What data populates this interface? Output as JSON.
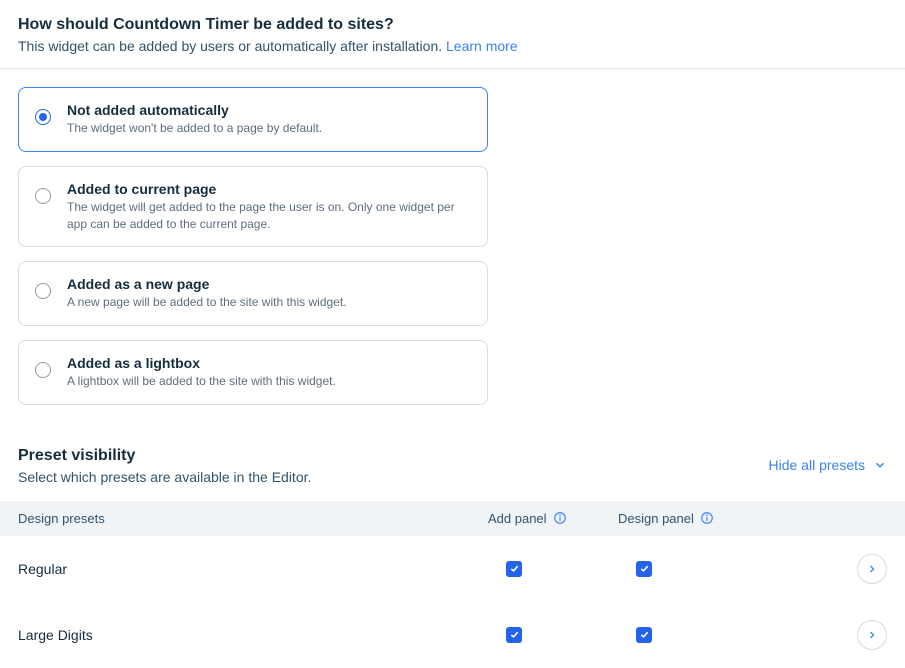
{
  "header": {
    "title": "How should Countdown Timer be added to sites?",
    "desc": "This widget can be added by users or automatically after installation. ",
    "learn_more": "Learn more"
  },
  "options": [
    {
      "title": "Not added automatically",
      "desc": "The widget won't be added to a page by default.",
      "selected": true
    },
    {
      "title": "Added to current page",
      "desc": "The widget will get added to the page the user is on. Only one widget per app can be added to the current page.",
      "selected": false
    },
    {
      "title": "Added as a new page",
      "desc": "A new page will be added to the site with this widget.",
      "selected": false
    },
    {
      "title": "Added as a lightbox",
      "desc": "A lightbox will be added to the site with this widget.",
      "selected": false
    }
  ],
  "preset": {
    "title": "Preset visibility",
    "desc": "Select which presets are available in the Editor.",
    "hide_all": "Hide all presets"
  },
  "table": {
    "col1": "Design presets",
    "col2": "Add panel",
    "col3": "Design panel",
    "rows": [
      {
        "name": "Regular",
        "add": true,
        "design": true
      },
      {
        "name": "Large Digits",
        "add": true,
        "design": true
      }
    ]
  }
}
